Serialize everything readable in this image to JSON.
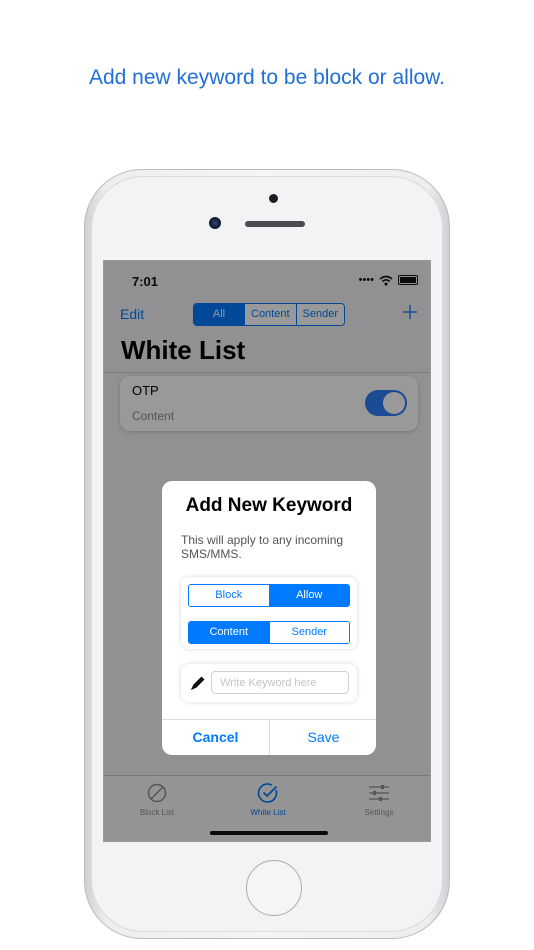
{
  "headline": "Add new keyword to be block or allow.",
  "status": {
    "time": "7:01"
  },
  "nav": {
    "edit_label": "Edit",
    "segments": [
      "All",
      "Content",
      "Sender"
    ],
    "selected_segment": "All",
    "add_icon": "plus-icon"
  },
  "page": {
    "title": "White List"
  },
  "list": {
    "items": [
      {
        "title": "OTP",
        "subtitle": "Content",
        "enabled": true
      }
    ]
  },
  "dialog": {
    "title": "Add New Keyword",
    "message": "This will apply to any incoming SMS/MMS.",
    "action_segment": {
      "options": [
        "Block",
        "Allow"
      ],
      "selected": "Allow"
    },
    "type_segment": {
      "options": [
        "Content",
        "Sender"
      ],
      "selected": "Content"
    },
    "keyword": {
      "value": "",
      "placeholder": "Write Keyword here"
    },
    "cancel_label": "Cancel",
    "save_label": "Save"
  },
  "tabbar": {
    "tabs": [
      {
        "label": "Block List",
        "icon": "block-icon",
        "active": false
      },
      {
        "label": "White List",
        "icon": "check-circle-icon",
        "active": true
      },
      {
        "label": "Settings",
        "icon": "sliders-icon",
        "active": false
      }
    ]
  },
  "colors": {
    "accent": "#007aff",
    "headline": "#1f6fd6",
    "toggle": "#2f7cf6"
  }
}
